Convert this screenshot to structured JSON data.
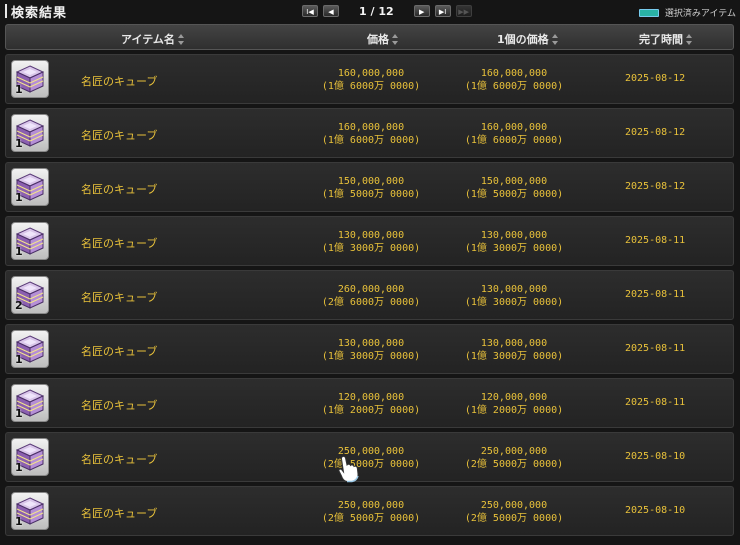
{
  "header": {
    "title": "検索結果",
    "pager": {
      "text": "1 / 12",
      "first": "I◀",
      "prev": "◀",
      "next": "▶",
      "last": "▶I",
      "extra": "▶▶"
    },
    "legend": {
      "label": "選択済みアイテム",
      "color": "#29b3a6"
    }
  },
  "columns": {
    "item_name": "アイテム名",
    "price": "価格",
    "unit_price": "1個の価格",
    "end_time": "完了時間"
  },
  "rows": [
    {
      "qty": "1",
      "name": "名匠のキューブ",
      "price": "160,000,000",
      "price_sub": "(1億 6000万 0000)",
      "unit_price": "160,000,000",
      "unit_sub": "(1億 6000万 0000)",
      "date": "2025-08-12"
    },
    {
      "qty": "1",
      "name": "名匠のキューブ",
      "price": "160,000,000",
      "price_sub": "(1億 6000万 0000)",
      "unit_price": "160,000,000",
      "unit_sub": "(1億 6000万 0000)",
      "date": "2025-08-12"
    },
    {
      "qty": "1",
      "name": "名匠のキューブ",
      "price": "150,000,000",
      "price_sub": "(1億 5000万 0000)",
      "unit_price": "150,000,000",
      "unit_sub": "(1億 5000万 0000)",
      "date": "2025-08-12"
    },
    {
      "qty": "1",
      "name": "名匠のキューブ",
      "price": "130,000,000",
      "price_sub": "(1億 3000万 0000)",
      "unit_price": "130,000,000",
      "unit_sub": "(1億 3000万 0000)",
      "date": "2025-08-11"
    },
    {
      "qty": "2",
      "name": "名匠のキューブ",
      "price": "260,000,000",
      "price_sub": "(2億 6000万 0000)",
      "unit_price": "130,000,000",
      "unit_sub": "(1億 3000万 0000)",
      "date": "2025-08-11"
    },
    {
      "qty": "1",
      "name": "名匠のキューブ",
      "price": "130,000,000",
      "price_sub": "(1億 3000万 0000)",
      "unit_price": "130,000,000",
      "unit_sub": "(1億 3000万 0000)",
      "date": "2025-08-11"
    },
    {
      "qty": "1",
      "name": "名匠のキューブ",
      "price": "120,000,000",
      "price_sub": "(1億 2000万 0000)",
      "unit_price": "120,000,000",
      "unit_sub": "(1億 2000万 0000)",
      "date": "2025-08-11"
    },
    {
      "qty": "1",
      "name": "名匠のキューブ",
      "price": "250,000,000",
      "price_sub": "(2億 5000万 0000)",
      "unit_price": "250,000,000",
      "unit_sub": "(2億 5000万 0000)",
      "date": "2025-08-10"
    },
    {
      "qty": "1",
      "name": "名匠のキューブ",
      "price": "250,000,000",
      "price_sub": "(2億 5000万 0000)",
      "unit_price": "250,000,000",
      "unit_sub": "(2億 5000万 0000)",
      "date": "2025-08-10"
    }
  ],
  "icons": {
    "item": "cube-icon",
    "cursor": "hand-cursor-icon"
  }
}
